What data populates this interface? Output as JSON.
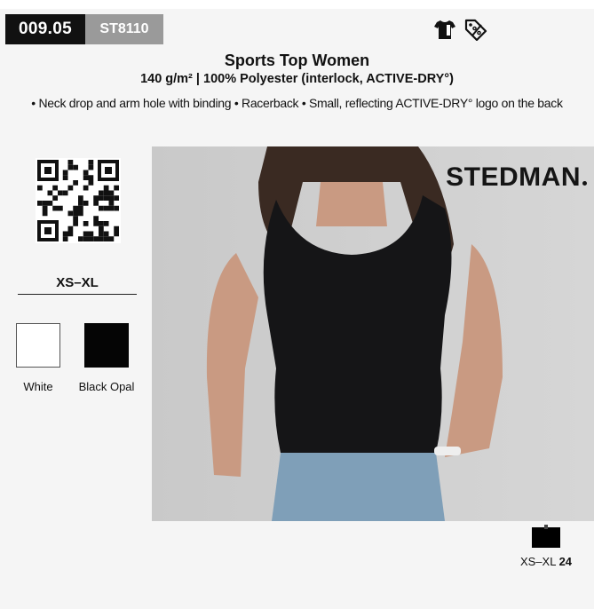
{
  "header": {
    "code_main": "009.05",
    "code_sub": "ST8110",
    "icons": [
      "tshirt-icon",
      "sale-tag-icon"
    ]
  },
  "product": {
    "title": "Sports Top Women",
    "subtitle": "140 g/m² | 100% Polyester (interlock, ACTIVE-DRY°)",
    "features": "• Neck drop and arm hole with binding • Racerback • Small, reflecting ACTIVE-DRY° logo on the back"
  },
  "sizes": {
    "range": "XS–XL"
  },
  "colors": [
    {
      "name": "White",
      "hex": "#ffffff"
    },
    {
      "name": "Black Opal",
      "hex": "#050505"
    }
  ],
  "photo": {
    "brand": "STEDMAN"
  },
  "packaging": {
    "size_label": "XS–XL",
    "quantity": "24"
  }
}
